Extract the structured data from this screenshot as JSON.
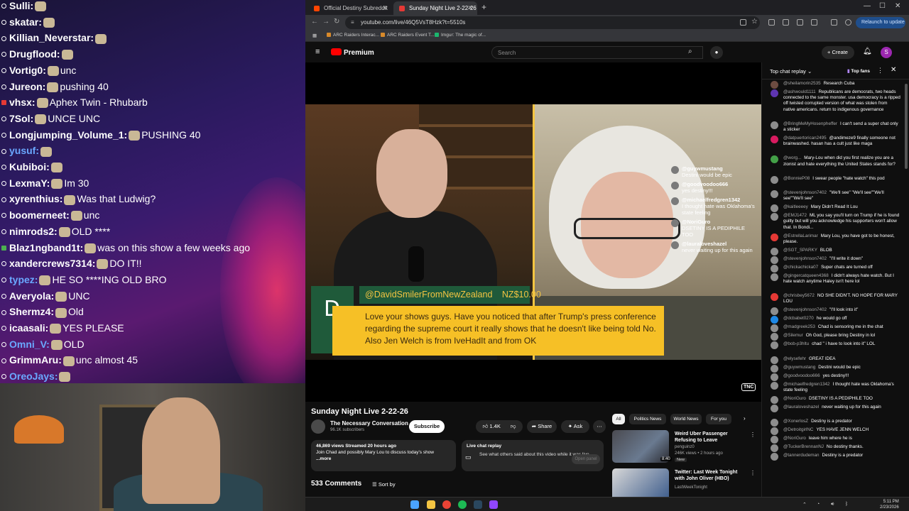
{
  "overlay_chat": [
    {
      "user": "Sulli:",
      "msg": ""
    },
    {
      "user": "skatar:",
      "msg": ""
    },
    {
      "user": "Killian_Neverstar:",
      "msg": ""
    },
    {
      "user": "Drugflood:",
      "msg": ""
    },
    {
      "user": "Vortig0:",
      "msg": "unc"
    },
    {
      "user": "Jureon:",
      "msg": "pushing 40"
    },
    {
      "user": "vhsx:",
      "msg": "Aphex Twin - Rhubarb"
    },
    {
      "user": "7Sol:",
      "msg": "UNCE UNC"
    },
    {
      "user": "Longjumping_Volume_1:",
      "msg": "PUSHING 40"
    },
    {
      "user": "yusuf:",
      "msg": ""
    },
    {
      "user": "Kubiboi:",
      "msg": ""
    },
    {
      "user": "LexmaY:",
      "msg": "Im 30"
    },
    {
      "user": "xyrenthius:",
      "msg": "Was that Ludwig?"
    },
    {
      "user": "boomerneet:",
      "msg": "unc"
    },
    {
      "user": "nimrods2:",
      "msg": "OLD ****"
    },
    {
      "user": "Blaz1ngband1t:",
      "msg": "was on this show a few weeks ago"
    },
    {
      "user": "xandercrews7314:",
      "msg": "DO IT!!"
    },
    {
      "user": "typez:",
      "msg": "HE SO ****ING OLD BRO"
    },
    {
      "user": "Averyola:",
      "msg": "UNC"
    },
    {
      "user": "Shermz4:",
      "msg": "Old"
    },
    {
      "user": "icaasali:",
      "msg": "YES PLEASE"
    },
    {
      "user": "Omni_V:",
      "msg": "OLD"
    },
    {
      "user": "GrimmAru:",
      "msg": "unc almost 45"
    },
    {
      "user": "OreoJays:",
      "msg": ""
    }
  ],
  "browser": {
    "tabs": [
      {
        "title": "Official Destiny Subreddit"
      },
      {
        "title": "Sunday Night Live 2-22-26"
      }
    ],
    "url": "youtube.com/live/46Q5VsT8Hzk?t=5510s",
    "relaunch_label": "Relaunch to update",
    "bookmarks": [
      "ARC Raiders Interac...",
      "ARC Raiders Event T...",
      "Imgur: The magic of..."
    ]
  },
  "youtube": {
    "logo": "Premium",
    "search_placeholder": "Search",
    "create_label": "Create",
    "avatar_letter": "S"
  },
  "video": {
    "overlay_comments": [
      {
        "user": "@guywmustang",
        "text": "Destini would be epic"
      },
      {
        "user": "@goodvoodoo666",
        "text": "yes destiny!!!"
      },
      {
        "user": "@michaelfredgren1342",
        "text": "I thought hate was Oklahoma's state feeling"
      },
      {
        "user": "@NoriGuro",
        "text": "DSETINY IS A PEDIPHILE TOO"
      },
      {
        "user": "@lauraloveshazel",
        "text": "never waiting up for this again"
      }
    ],
    "superchat": {
      "letter": "D",
      "user": "@DavidSmilerFromNewZealand",
      "amount": "NZ$10.00",
      "text": "Love your shows guys. Have you noticed that after Trump's press conference regarding the supreme court it really shows that he doesn't like being told No. Also Jen Welch is from IveHadIt and from OK"
    },
    "corner_logo": "TNC",
    "title": "Sunday Night Live 2-22-26",
    "channel": "The Necessary Conversation",
    "subscribers": "96.1K subscribers",
    "subscribe_label": "Subscribe",
    "likes": "1.4K",
    "share_label": "Share",
    "ask_label": "Ask",
    "description_meta": "46,869 views  Streamed 20 hours ago",
    "description": "Join Chad and possibly Mary Lou to discuss today's show",
    "more_label": "...more",
    "replay_title": "Live chat replay",
    "replay_desc": "See what others said about this video while it was live.",
    "replay_button": "Open panel",
    "comments_count": "533 Comments",
    "sort_label": "Sort by"
  },
  "recommendations": {
    "chips": [
      "All",
      "Politics News",
      "World News",
      "For you"
    ],
    "items": [
      {
        "title": "Weird Uber Passenger Refusing to Leave",
        "channel": "penguinz0",
        "meta": "246K views • 2 hours ago",
        "badge": "New",
        "duration": "8:40"
      },
      {
        "title": "Twitter: Last Week Tonight with John Oliver (HBO)",
        "channel": "LastWeekTonight",
        "meta": "",
        "badge": "",
        "duration": ""
      }
    ]
  },
  "live_chat": {
    "title": "Top chat replay",
    "top_fans": "Top fans",
    "messages": [
      {
        "user": "@sheilamorin2535",
        "text": "Research Cuba",
        "color": "#6d4c41"
      },
      {
        "user": "@ashwould1111",
        "text": "Republicans are democrats, two heads connected to the same monster. usa democracy is a ripped off twisted corrupted version of what was stolen from native americans. return to indigenous governance",
        "color": "#5e35b1"
      },
      {
        "user": "@BringMeMyHosenpheffer",
        "text": "I can't send a super chat only a sticker",
        "color": "#8d8d8d"
      },
      {
        "user": "@datpuertorican2495",
        "text": "@andimeze9 finally someone not brainwashed. hasan has a cult just like maga",
        "color": "#d81b60"
      },
      {
        "user": "@worg...",
        "text": "Mary-Lou when did you first realize you are a zionist and hate everything the United States stands for?",
        "color": "#43a047"
      },
      {
        "user": "@BonnieP08",
        "text": "I swear people \"hate watch\" this pod",
        "color": "#8d8d8d"
      },
      {
        "user": "@stevenjohnson7402",
        "text": "\"We'll see\" \"We'll see\"\"We'll see\"\"We'll see\"",
        "color": "#8d8d8d"
      },
      {
        "user": "@kaitleeeey",
        "text": "Mary Didn't Read It Lou",
        "color": "#8d8d8d"
      },
      {
        "user": "@EMJ1472",
        "text": "ML you say you'll turn on Trump if he is found guilty but will you acknowledge his supporters won't allow that. In Bondi...",
        "color": "#8d8d8d"
      },
      {
        "user": "@EstrellaLarimar",
        "text": "Mary Lou, you have got to be honest, please.",
        "color": "#e53935"
      },
      {
        "user": "@SGT_SPARKY",
        "text": "BLOB",
        "color": "#8d8d8d"
      },
      {
        "user": "@stevenjohnson7402",
        "text": "\"I'll write it down\"",
        "color": "#8d8d8d"
      },
      {
        "user": "@chickachicka07",
        "text": "Super chats are turned off",
        "color": "#8d8d8d"
      },
      {
        "user": "@gingercatqueen4368",
        "text": "I didn't always hate watch. But I hate watch anytime Haley isn't here lol",
        "color": "#8d8d8d"
      },
      {
        "user": "@chrisbey5672",
        "text": "NO SHE DIDN'T. NO HOPE FOR MARY LOU",
        "color": "#e53935"
      },
      {
        "user": "@stevenjohnson7402",
        "text": "\"I'll look into it\"",
        "color": "#8d8d8d"
      },
      {
        "user": "@dcbabet0270",
        "text": "he would go off",
        "color": "#1e88e5"
      },
      {
        "user": "@madgreek253",
        "text": "Chad is sensoring me in the chat",
        "color": "#8d8d8d"
      },
      {
        "user": "@Silemur",
        "text": "Oh God, please bring Destiny in lol",
        "color": "#8d8d8d"
      },
      {
        "user": "@bob-p3hltu",
        "text": "chad \" i have to look into it\" LOL",
        "color": "#8d8d8d"
      },
      {
        "user": "@elysefehr",
        "text": "GREAT IDEA",
        "color": "#8d8d8d"
      },
      {
        "user": "@guywmustang",
        "text": "Destini would be epic",
        "color": "#8d8d8d"
      },
      {
        "user": "@goodvoodoo666",
        "text": "yes destiny!!!",
        "color": "#8d8d8d"
      },
      {
        "user": "@michaelfredgren1342",
        "text": "I thought hate was Oklahoma's state feeling",
        "color": "#8d8d8d"
      },
      {
        "user": "@NoriGuro",
        "text": "DSETINY IS A PEDIPHILE TOO",
        "color": "#8d8d8d"
      },
      {
        "user": "@lauraloveshazel",
        "text": "never waiting up for this again",
        "color": "#8d8d8d"
      },
      {
        "user": "@XonerlosZ",
        "text": "Destiny is a predator",
        "color": "#8d8d8d"
      },
      {
        "user": "@DetroitgirlNC",
        "text": "YES HAVE JENN WELCH",
        "color": "#8d8d8d"
      },
      {
        "user": "@NoriGuro",
        "text": "leave him where he is",
        "color": "#8d8d8d"
      },
      {
        "user": "@TuckerBrennanNJ",
        "text": "No destiny thanks.",
        "color": "#8d8d8d"
      },
      {
        "user": "@tannerdudeman",
        "text": "Destiny is a predator",
        "color": "#8d8d8d"
      }
    ]
  },
  "taskbar": {
    "time": "5:11 PM",
    "date": "2/23/2026"
  }
}
